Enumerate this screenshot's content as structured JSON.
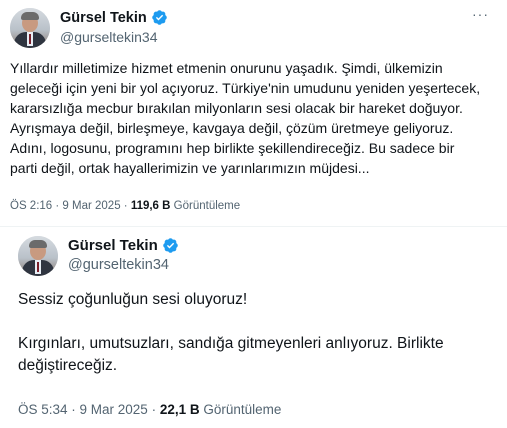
{
  "tweets": [
    {
      "author": {
        "name": "Gürsel Tekin",
        "handle": "@gurseltekin34"
      },
      "more_label": "···",
      "text_lines": [
        "Yıllardır milletimize hizmet etmenin onurunu yaşadık. Şimdi, ülkemizin",
        "geleceği için yeni bir yol açıyoruz. Türkiye'nin umudunu yeniden yeşertecek,",
        "kararsızlığa mecbur bırakılan milyonların sesi olacak bir hareket doğuyor.",
        "Ayrışmaya değil, birleşmeye, kavgaya değil, çözüm üretmeye geliyoruz.",
        "Adını, logosunu, programını hep birlikte şekillendireceğiz. Bu sadece bir",
        "parti değil, ortak hayallerimizin ve yarınlarımızın müjdesi..."
      ],
      "time": "ÖS 2:16 · 9 Mar 2025 · ",
      "views": "119,6 B",
      "views_label": " Görüntüleme"
    },
    {
      "author": {
        "name": "Gürsel Tekin",
        "handle": "@gurseltekin34"
      },
      "text_lines": [
        "Sessiz çoğunluğun sesi oluyoruz!",
        "",
        "Kırgınları, umutsuzları, sandığa gitmeyenleri anlıyoruz. Birlikte",
        "değiştireceğiz."
      ],
      "time": "ÖS 5:34 · 9 Mar 2025 · ",
      "views": "22,1 B",
      "views_label": " Görüntüleme"
    }
  ],
  "colors": {
    "verified": "#1d9bf0",
    "secondary_text": "#536471",
    "primary_text": "#0f1419"
  }
}
